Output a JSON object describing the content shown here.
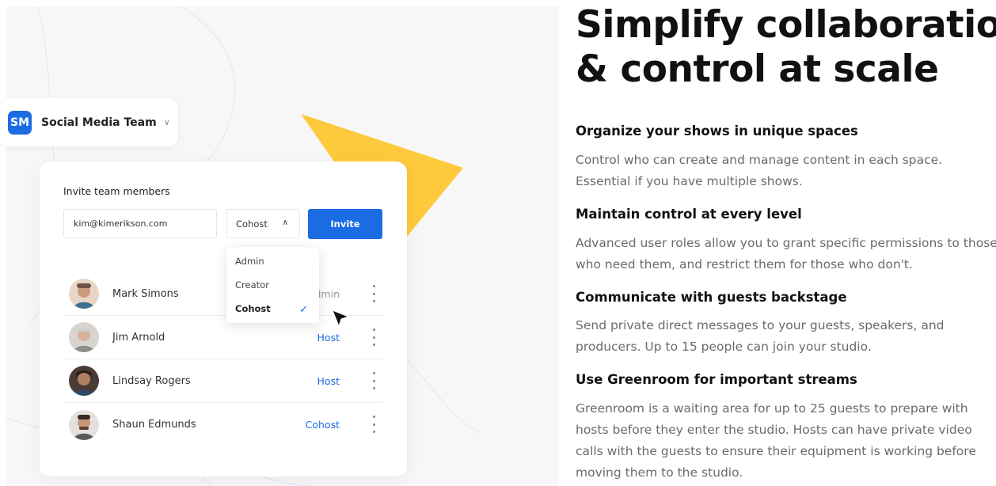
{
  "left": {
    "team": {
      "initials": "SM",
      "name": "Social Media Team"
    },
    "invite": {
      "title": "Invite team members",
      "email_value": "kim@kimerikson.com",
      "role_selected": "Cohost",
      "button_label": "Invite",
      "dropdown_options": [
        "Admin",
        "Creator",
        "Cohost"
      ]
    },
    "members": [
      {
        "name": "Mark Simons",
        "role": "Admin"
      },
      {
        "name": "Jim Arnold",
        "role": "Host"
      },
      {
        "name": "Lindsay Rogers",
        "role": "Host"
      },
      {
        "name": "Shaun Edmunds",
        "role": "Cohost"
      }
    ],
    "colors": {
      "accent": "#1b6be5",
      "yellow": "#ffc93c"
    }
  },
  "right": {
    "headline_line1": "Simplify collaboration",
    "headline_line2": "& control at scale",
    "features": [
      {
        "title": "Organize your shows in unique spaces",
        "body": "Control who can create and manage content in each space. Essential if you have multiple shows."
      },
      {
        "title": "Maintain control at every level",
        "body": "Advanced user roles allow you to grant specific permissions to those who need them, and restrict them for those who don't."
      },
      {
        "title": "Communicate with guests backstage",
        "body": "Send private direct messages to your guests, speakers, and producers. Up to 15 people can join your studio."
      },
      {
        "title": "Use Greenroom for important streams",
        "body": "Greenroom is a waiting area for up to 25 guests to prepare with hosts before they enter the studio. Hosts can have private video calls with the guests to ensure their equipment is working before moving them to the studio."
      }
    ]
  }
}
